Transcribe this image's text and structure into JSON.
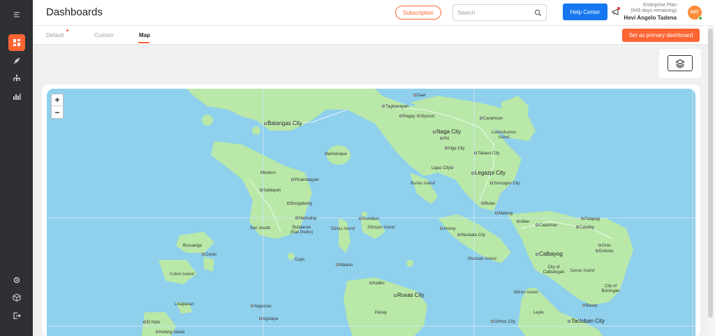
{
  "header": {
    "title": "Dashboards",
    "subscription_label": "Subscription",
    "search_placeholder": "Search",
    "help_label": "Help Center",
    "plan_line1": "Enterprise Plan",
    "plan_line2": "(649 days remaining)",
    "user_name": "Hevi Angelo Tadena",
    "avatar_initials": "HAT"
  },
  "tabs": [
    {
      "label": "Default"
    },
    {
      "label": "Custom"
    },
    {
      "label": "Map",
      "active": true
    }
  ],
  "primary_button": "Set as primary dashboard",
  "map": {
    "zoom_in": "+",
    "zoom_out": "−",
    "labels": [
      {
        "text": "Daet"
      },
      {
        "text": "Tagkawayan"
      },
      {
        "text": "Ragay"
      },
      {
        "text": "Sipocot"
      },
      {
        "text": "Caramoan"
      },
      {
        "text": "Batangas City"
      },
      {
        "text": "Naga City"
      },
      {
        "text": "Pili"
      },
      {
        "text": "Catanduanes Island"
      },
      {
        "text": "Iriga City"
      },
      {
        "text": "Tabaco City"
      },
      {
        "text": "Marinduque"
      },
      {
        "text": "Ligao City"
      },
      {
        "text": "Legazpi City"
      },
      {
        "text": "Mindoro"
      },
      {
        "text": "Pinamalayan"
      },
      {
        "text": "Burias Island"
      },
      {
        "text": "Sorsogon City"
      },
      {
        "text": "Sablayan"
      },
      {
        "text": "Bulan"
      },
      {
        "text": "Bongabong"
      },
      {
        "text": "Matnog"
      },
      {
        "text": "Mansalay"
      },
      {
        "text": "Romblon"
      },
      {
        "text": "Allen"
      },
      {
        "text": "Catarman"
      },
      {
        "text": "Palapag"
      },
      {
        "text": "San Jose"
      },
      {
        "text": "Bulalacao (San Pedro)"
      },
      {
        "text": "Tablas Island"
      },
      {
        "text": "Sibuyan Island"
      },
      {
        "text": "Aroroy"
      },
      {
        "text": "Masbate City"
      },
      {
        "text": "Catubig"
      },
      {
        "text": "Busuanga"
      },
      {
        "text": "Oras"
      },
      {
        "text": "Coron"
      },
      {
        "text": "Dolores"
      },
      {
        "text": "Cuyo"
      },
      {
        "text": "Calbayog"
      },
      {
        "text": "Masbate Island"
      },
      {
        "text": "Maasin"
      },
      {
        "text": "City of Catbalogan"
      },
      {
        "text": "Culion Island"
      },
      {
        "text": "Samar Island"
      },
      {
        "text": "Kalibo"
      },
      {
        "text": "Roxas City"
      },
      {
        "text": "Biliran Island"
      },
      {
        "text": "City of Borongan"
      },
      {
        "text": "Linapacan"
      },
      {
        "text": "Algeciras"
      },
      {
        "text": "Basey"
      },
      {
        "text": "Panay"
      },
      {
        "text": "Leyte"
      },
      {
        "text": "Agutaya"
      },
      {
        "text": "El Nido"
      },
      {
        "text": "Ormoc City"
      },
      {
        "text": "Tacloban City"
      },
      {
        "text": "Kelong Island"
      }
    ]
  }
}
